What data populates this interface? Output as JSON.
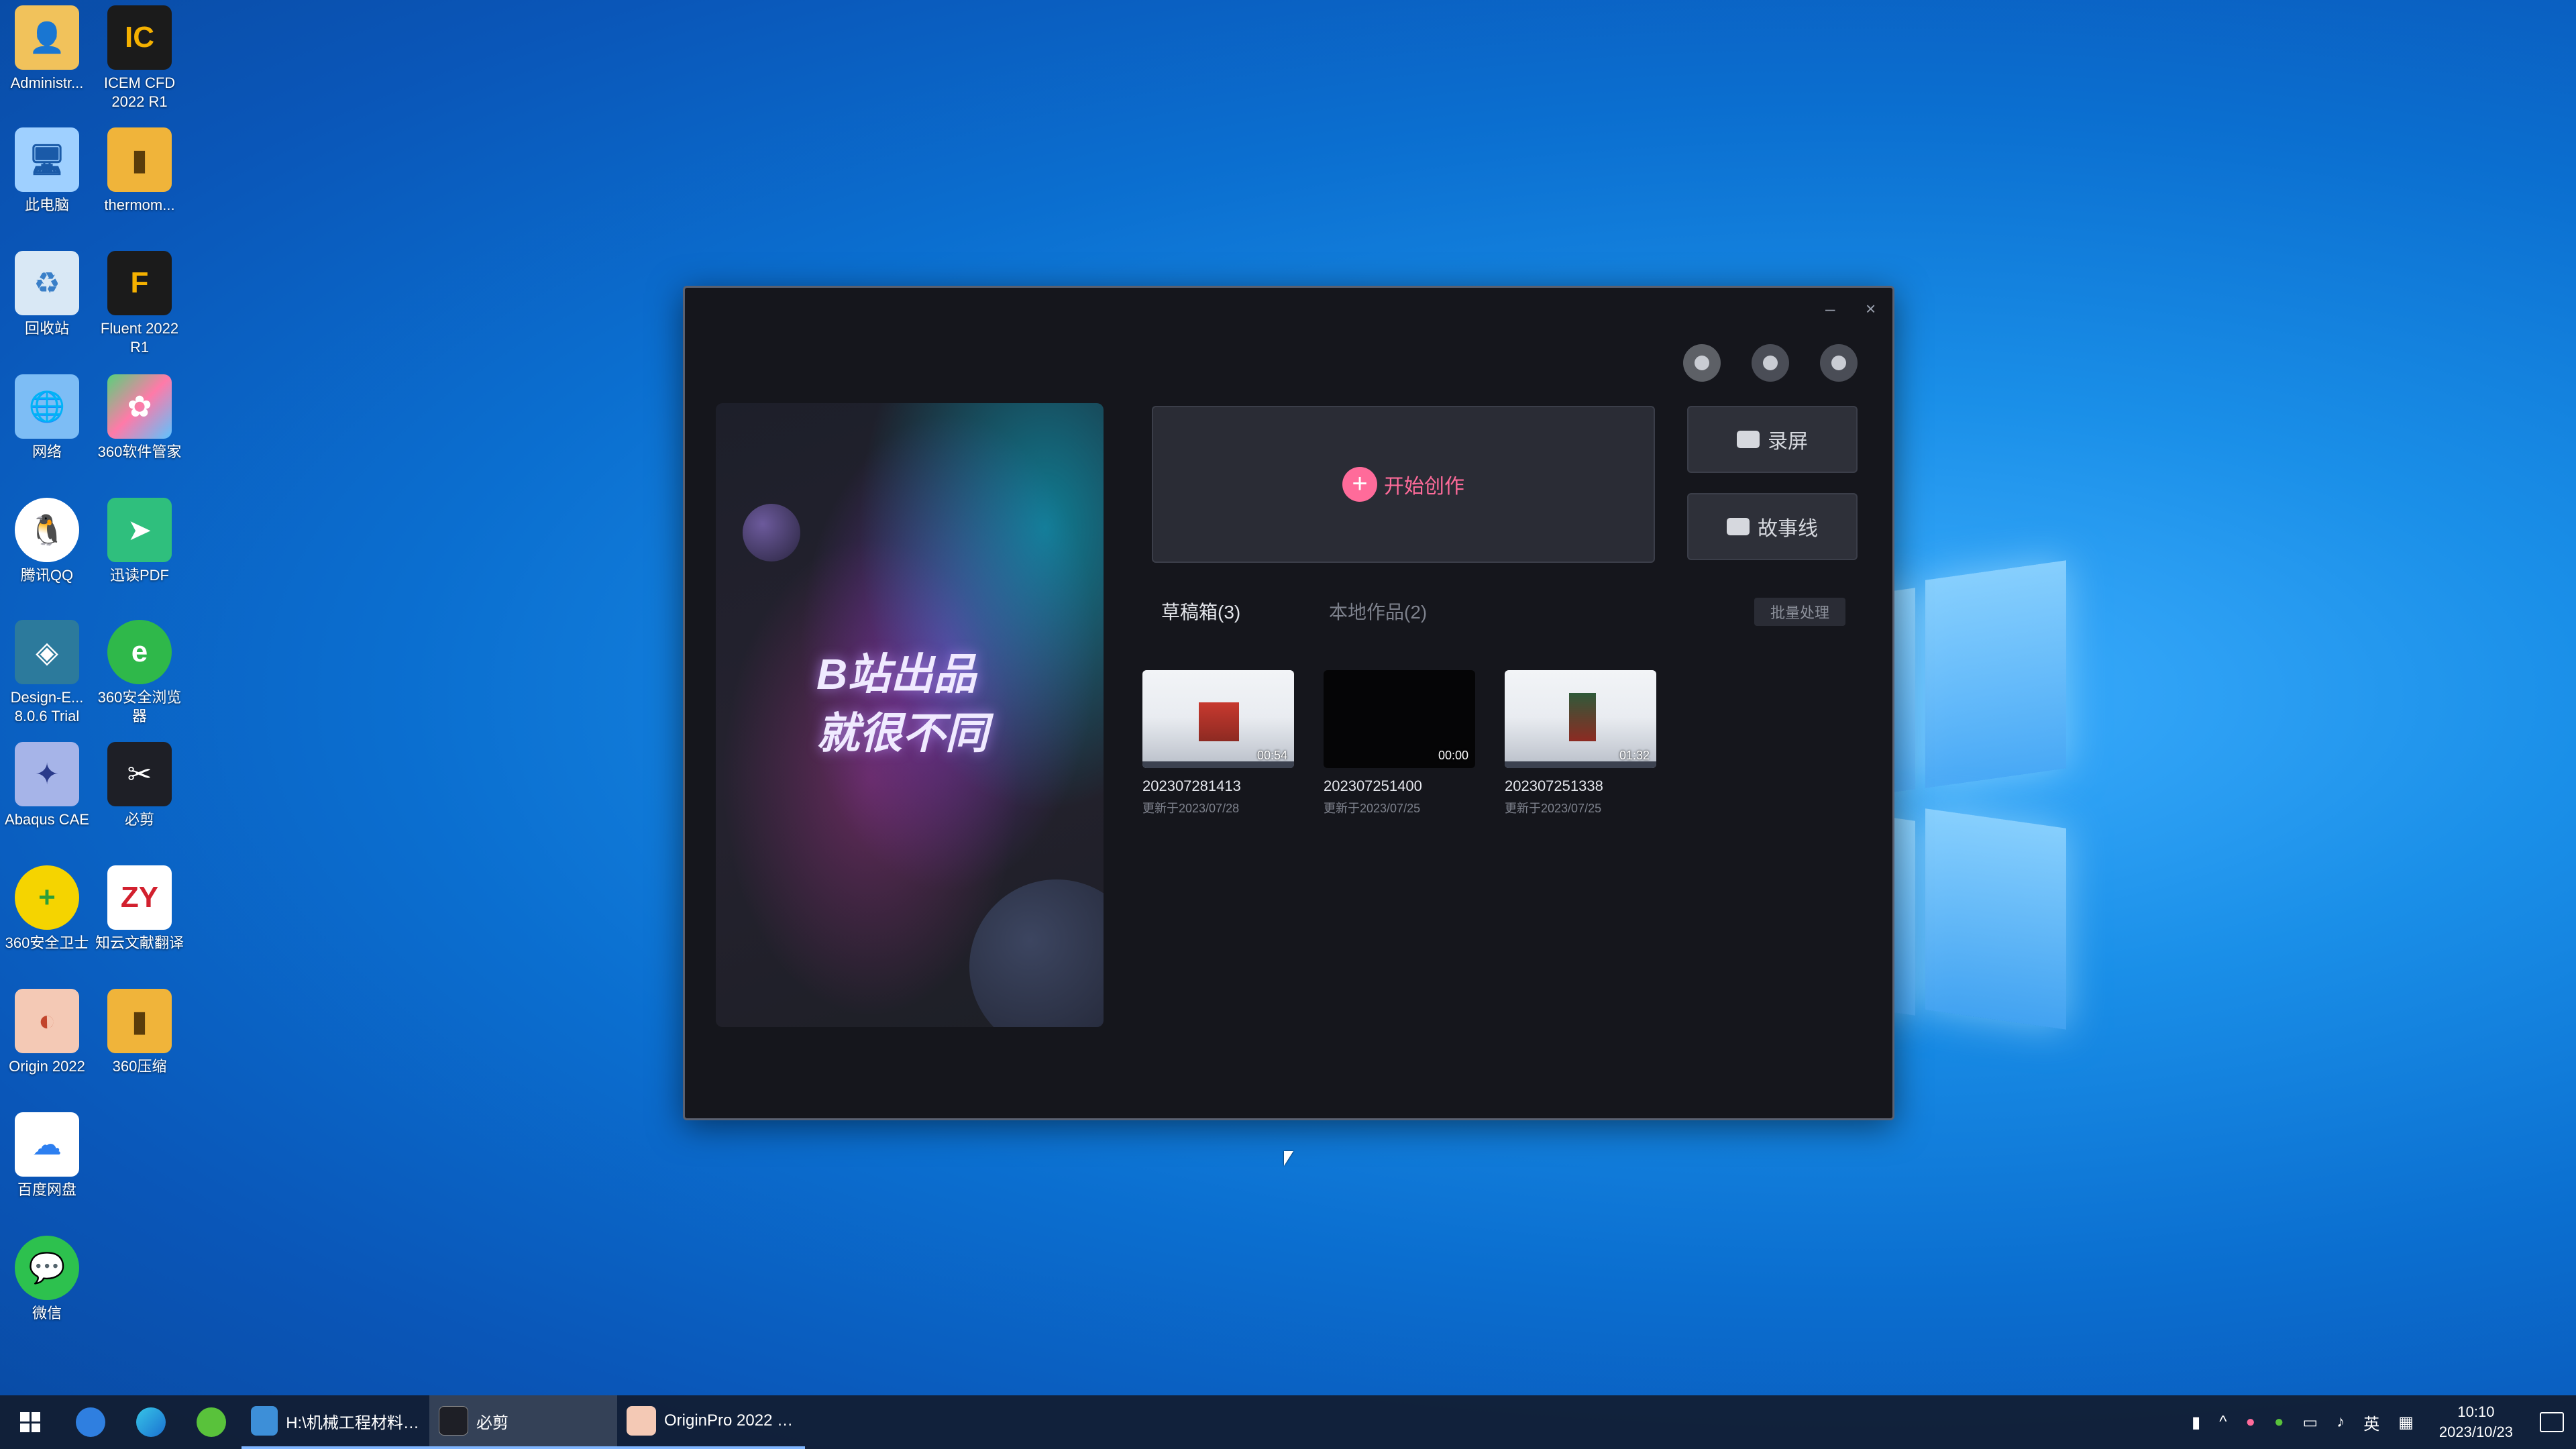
{
  "desktop": {
    "icons": [
      {
        "label": "Administr...",
        "icon": "user-folder-icon"
      },
      {
        "label": "ICEM CFD 2022 R1",
        "icon": "icem-cfd-icon"
      },
      {
        "label": "此电脑",
        "icon": "computer-icon"
      },
      {
        "label": "thermom...",
        "icon": "archive-folder-icon"
      },
      {
        "label": "回收站",
        "icon": "recycle-bin-icon"
      },
      {
        "label": "Fluent 2022 R1",
        "icon": "fluent-icon"
      },
      {
        "label": "网络",
        "icon": "network-icon"
      },
      {
        "label": "360软件管家",
        "icon": "360-software-icon"
      },
      {
        "label": "腾讯QQ",
        "icon": "qq-icon"
      },
      {
        "label": "迅读PDF",
        "icon": "pdf-reader-icon"
      },
      {
        "label": "Design-E... 8.0.6 Trial",
        "icon": "design-expert-icon"
      },
      {
        "label": "360安全浏览器",
        "icon": "360-browser-icon"
      },
      {
        "label": "Abaqus CAE",
        "icon": "abaqus-icon"
      },
      {
        "label": "必剪",
        "icon": "bijian-icon"
      },
      {
        "label": "360安全卫士",
        "icon": "360-security-icon"
      },
      {
        "label": "知云文献翻译",
        "icon": "zhiyun-icon"
      },
      {
        "label": "Origin 2022",
        "icon": "origin-icon"
      },
      {
        "label": "360压缩",
        "icon": "360-zip-icon"
      },
      {
        "label": "百度网盘",
        "icon": "baidu-netdisk-icon"
      },
      {
        "label": "微信",
        "icon": "wechat-icon"
      }
    ]
  },
  "app": {
    "window_controls": {
      "minimize": "–",
      "close": "×"
    },
    "banner": {
      "line1": "B站出品",
      "line2": "就很不同"
    },
    "create_button": {
      "label": "开始创作",
      "icon": "plus-icon"
    },
    "record_button": {
      "label": "录屏",
      "icon": "camera-icon"
    },
    "story_button": {
      "label": "故事线",
      "icon": "camera-icon"
    },
    "tabs": [
      {
        "label": "草稿箱(3)",
        "active": true
      },
      {
        "label": "本地作品(2)",
        "active": false
      }
    ],
    "batch_button": {
      "label": "批量处理"
    },
    "drafts": [
      {
        "name": "202307281413",
        "updated": "更新于2023/07/28",
        "duration": "00:54",
        "thumb": "image"
      },
      {
        "name": "202307251400",
        "updated": "更新于2023/07/25",
        "duration": "00:00",
        "thumb": "dark"
      },
      {
        "name": "202307251338",
        "updated": "更新于2023/07/25",
        "duration": "01:32",
        "thumb": "image"
      }
    ]
  },
  "taskbar": {
    "tasks": [
      {
        "label": "H:\\机械工程材料—...",
        "active": false
      },
      {
        "label": "必剪",
        "active": true
      },
      {
        "label": "OriginPro 2022 (...",
        "active": false
      }
    ],
    "tray": {
      "ime": "英",
      "time": "10:10",
      "date": "2023/10/23"
    }
  },
  "colors": {
    "accent_pink": "#ff6b9a",
    "window_bg": "#15161c",
    "desktop_blue": "#0b6fd0"
  }
}
